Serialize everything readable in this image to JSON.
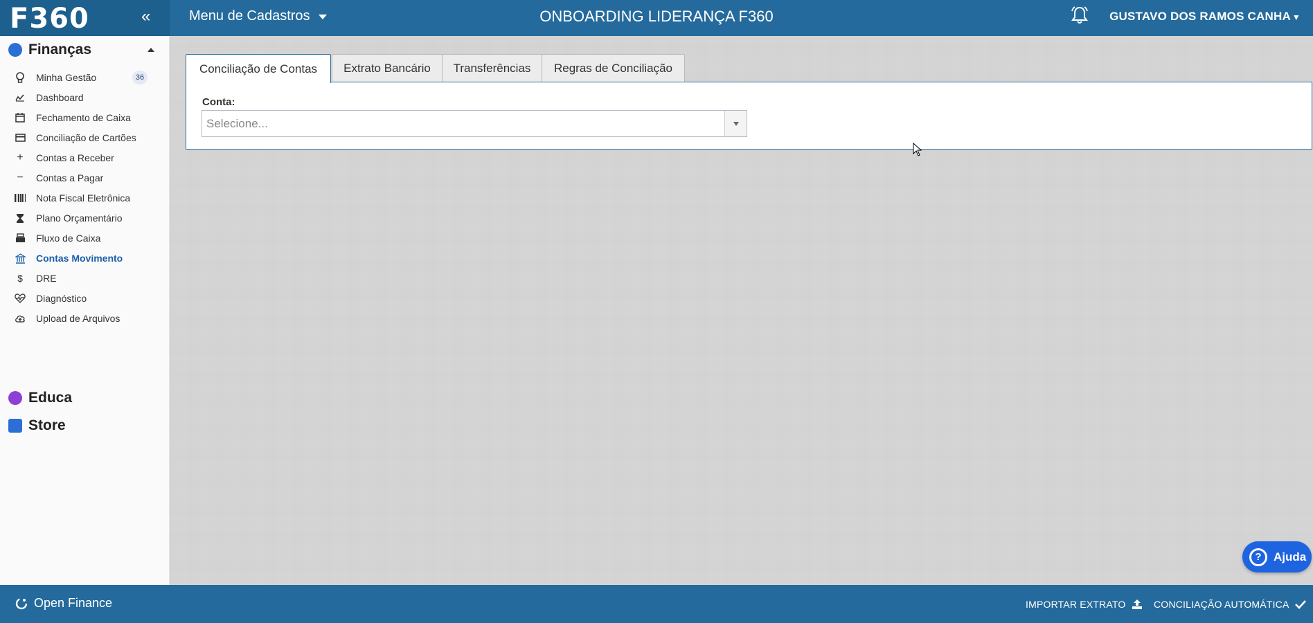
{
  "header": {
    "logo": "F360",
    "menu_label": "Menu de Cadastros",
    "company": "ONBOARDING LIDERANÇA F360",
    "user": "GUSTAVO DOS RAMOS CANHA"
  },
  "sidebar": {
    "sections": [
      {
        "label": "Finanças",
        "color": "#2b6fd6"
      },
      {
        "label": "Educa",
        "color": "#8d3fd6"
      },
      {
        "label": "Store",
        "color": "#2b6fd6"
      }
    ],
    "items": [
      {
        "label": "Minha Gestão",
        "icon": "lightbulb-icon",
        "badge": "36"
      },
      {
        "label": "Dashboard",
        "icon": "chart-icon"
      },
      {
        "label": "Fechamento de Caixa",
        "icon": "calendar-icon"
      },
      {
        "label": "Conciliação de Cartões",
        "icon": "credit-card-icon"
      },
      {
        "label": "Contas a Receber",
        "icon": "plus-icon"
      },
      {
        "label": "Contas a Pagar",
        "icon": "minus-icon"
      },
      {
        "label": "Nota Fiscal Eletrônica",
        "icon": "barcode-icon"
      },
      {
        "label": "Plano Orçamentário",
        "icon": "hourglass-icon"
      },
      {
        "label": "Fluxo de Caixa",
        "icon": "cash-register-icon"
      },
      {
        "label": "Contas Movimento",
        "icon": "bank-icon",
        "active": true
      },
      {
        "label": "DRE",
        "icon": "dollar-icon"
      },
      {
        "label": "Diagnóstico",
        "icon": "heartbeat-icon"
      },
      {
        "label": "Upload de Arquivos",
        "icon": "cloud-upload-icon"
      }
    ]
  },
  "tabs": [
    "Conciliação de Contas",
    "Extrato Bancário",
    "Transferências",
    "Regras de Conciliação"
  ],
  "form": {
    "help": "?",
    "conta_label": "Conta:",
    "select_placeholder": "Selecione..."
  },
  "ajuda": "Ajuda",
  "footer": {
    "open_finance": "Open Finance",
    "importar": "IMPORTAR EXTRATO",
    "conciliacao": "CONCILIAÇÃO AUTOMÁTICA"
  },
  "colors": {
    "topbar": "#256a9c",
    "accent": "#1a5fa8",
    "ajuda": "#1e63e0"
  }
}
